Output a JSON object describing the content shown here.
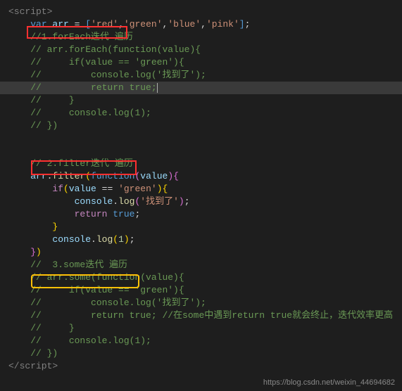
{
  "code": {
    "l1": "<script>",
    "l2_var": "var",
    "l2_arr": " arr ",
    "l2_eq": "= ",
    "l2_items": [
      "'red'",
      "'green'",
      "'blue'",
      "'pink'"
    ],
    "l3": "//1.forEach迭代 遍历",
    "l4": "// arr.forEach(function(value){",
    "l5": "//     if(value == 'green'){",
    "l6": "//         console.log('找到了');",
    "l7": "//         return true;",
    "l8": "//     }",
    "l9": "//     console.log(1);",
    "l10": "// })",
    "l11": "",
    "l12": "",
    "l13": "// 2.filter迭代 遍历",
    "l14_arr": "arr",
    "l14_filter": "filter",
    "l14_function": "function",
    "l14_value": "value",
    "l15_if": "if",
    "l15_value": "value",
    "l15_eq": " == ",
    "l15_green": "'green'",
    "l16_console": "console",
    "l16_log": "log",
    "l16_str": "'找到了'",
    "l17_return": "return",
    "l17_true": " true",
    "l18": "}",
    "l19_console": "console",
    "l19_log": "log",
    "l19_num": "1",
    "l20": "})",
    "l21": "//  3.some迭代 遍历",
    "l22": "// arr.some(function(value){",
    "l23": "//     if(value == 'green'){",
    "l24": "//         console.log('找到了');",
    "l25": "//         return true; //在some中遇到return true就会终止，迭代效率更高",
    "l26": "//     }",
    "l27": "//     console.log(1);",
    "l28": "// })",
    "l29": "</script>"
  },
  "watermark": "https://blog.csdn.net/weixin_44694682"
}
